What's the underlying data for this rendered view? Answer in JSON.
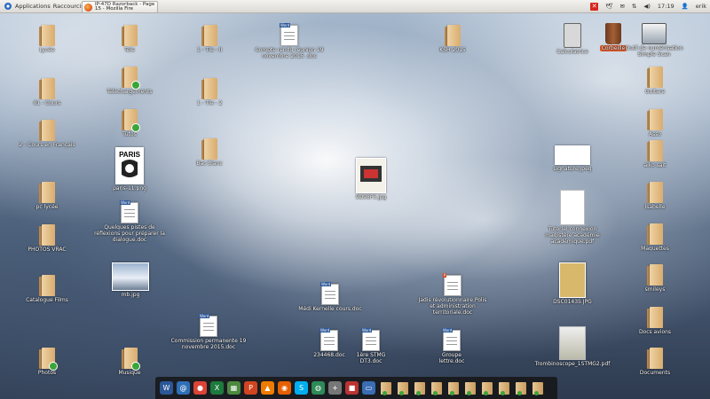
{
  "topbar": {
    "applications": "Applications",
    "places": "Raccourcis",
    "task": "IP-47D Razorback - Page 15 - Mozilla Fire",
    "clock": "17:19",
    "user": "erik"
  },
  "left_column": [
    {
      "label": "Lycée"
    },
    {
      "label": "01 - Cours"
    },
    {
      "label": "2 - Cours en Français"
    },
    {
      "label": "pc lycée"
    },
    {
      "label": "PHOTOS VRAC"
    },
    {
      "label": "Catalogue Films"
    },
    {
      "label": "Photos"
    }
  ],
  "col2": [
    {
      "label": "Tele"
    },
    {
      "label": "Téléchargements"
    },
    {
      "label": "Tutos"
    },
    {
      "label": "paris-11.png"
    },
    {
      "label": "Quelques pistes de réflexions pour préparer la dialogue.doc"
    },
    {
      "label": "mb.jpg"
    },
    {
      "label": "Musique"
    }
  ],
  "col3": [
    {
      "label": "1 - Tle - II"
    },
    {
      "label": "1 - Tle - 2"
    },
    {
      "label": "Bac blanc"
    },
    {
      "label": "Commission permanente 19 novembre 2015.doc"
    }
  ],
  "center_items": [
    {
      "label": "Compte rendu réunion 19 novembre 2015 .doc"
    },
    {
      "label": "KSH 2015"
    },
    {
      "label": "9D98F3.jpg"
    },
    {
      "label": "Médi Kernelle cours.doc"
    },
    {
      "label": "Jadis révolutionnaire Polis et administration territoriale.doc"
    },
    {
      "label": "234468.doc"
    },
    {
      "label": "1ère STMG DT3.doc"
    },
    {
      "label": "Groupe lettre.doc"
    }
  ],
  "right_items": [
    {
      "label": "Calculatrice"
    },
    {
      "label": "Corbeille"
    },
    {
      "label": "Outil de numérisation Simple Scan"
    },
    {
      "label": "Guitare"
    },
    {
      "label": "Asso"
    },
    {
      "label": "signature.jpeg"
    },
    {
      "label": "aiko sait"
    },
    {
      "label": "Isabelle"
    },
    {
      "label": "Tutoriel connexion magistère académie académique.pdf"
    },
    {
      "label": "Maquettes"
    },
    {
      "label": "DSC01435.JPG"
    },
    {
      "label": "smileys"
    },
    {
      "label": "Docs avions"
    },
    {
      "label": "Trombinoscope_1STMG2.pdf"
    },
    {
      "label": "Documents"
    }
  ],
  "dock_apps": [
    {
      "name": "word-icon",
      "glyph": "W",
      "color": "#2b5797"
    },
    {
      "name": "thunderbird-icon",
      "glyph": "@",
      "color": "#2f6fb7"
    },
    {
      "name": "chrome-icon",
      "glyph": "●",
      "color": "#db4437"
    },
    {
      "name": "calc-icon",
      "glyph": "X",
      "color": "#1d7a3c"
    },
    {
      "name": "table-icon",
      "glyph": "▦",
      "color": "#4c8a3f"
    },
    {
      "name": "impress-icon",
      "glyph": "P",
      "color": "#d04520"
    },
    {
      "name": "vlc-icon",
      "glyph": "▲",
      "color": "#ef7c00"
    },
    {
      "name": "firefox-icon",
      "glyph": "◉",
      "color": "#e66000"
    },
    {
      "name": "skype-icon",
      "glyph": "S",
      "color": "#00aff0"
    },
    {
      "name": "globe-icon",
      "glyph": "◍",
      "color": "#2e8b57"
    },
    {
      "name": "plus-icon",
      "glyph": "+",
      "color": "#777"
    },
    {
      "name": "gift-icon",
      "glyph": "■",
      "color": "#b33"
    },
    {
      "name": "monitor-icon",
      "glyph": "▭",
      "color": "#3a6db3"
    }
  ]
}
